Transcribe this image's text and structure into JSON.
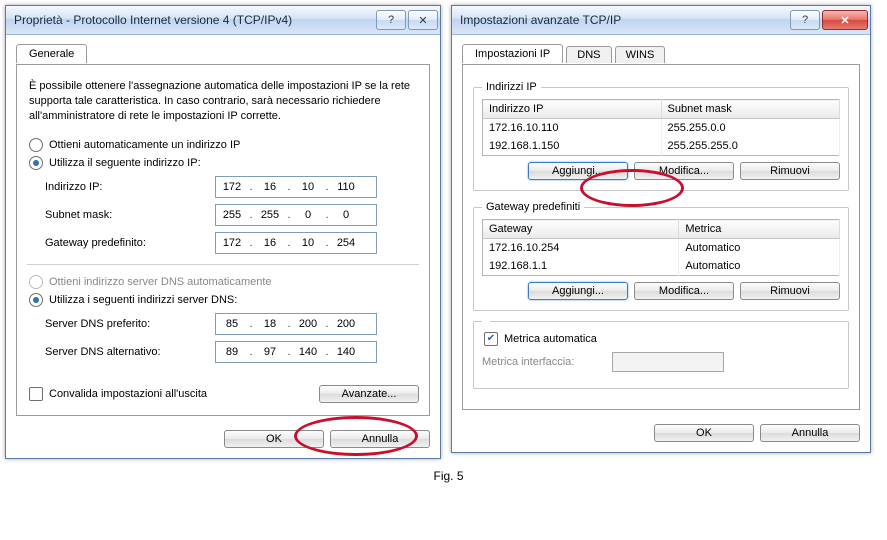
{
  "figure_caption": "Fig. 5",
  "left": {
    "title": "Proprietà - Protocollo Internet versione 4 (TCP/IPv4)",
    "tab_general": "Generale",
    "intro": "È possibile ottenere l'assegnazione automatica delle impostazioni IP se la rete supporta tale caratteristica. In caso contrario, sarà necessario richiedere all'amministratore di rete le impostazioni IP corrette.",
    "radio_auto_ip": "Ottieni automaticamente un indirizzo IP",
    "radio_use_ip": "Utilizza il seguente indirizzo IP:",
    "label_ip": "Indirizzo IP:",
    "label_mask": "Subnet mask:",
    "label_gw": "Gateway predefinito:",
    "ip": {
      "a": "172",
      "b": "16",
      "c": "10",
      "d": "110"
    },
    "mask": {
      "a": "255",
      "b": "255",
      "c": "0",
      "d": "0"
    },
    "gw": {
      "a": "172",
      "b": "16",
      "c": "10",
      "d": "254"
    },
    "radio_auto_dns": "Ottieni indirizzo server DNS automaticamente",
    "radio_use_dns": "Utilizza i seguenti indirizzi server DNS:",
    "label_dns1": "Server DNS preferito:",
    "label_dns2": "Server DNS alternativo:",
    "dns1": {
      "a": "85",
      "b": "18",
      "c": "200",
      "d": "200"
    },
    "dns2": {
      "a": "89",
      "b": "97",
      "c": "140",
      "d": "140"
    },
    "validate": "Convalida impostazioni all'uscita",
    "btn_adv": "Avanzate...",
    "btn_ok": "OK",
    "btn_cancel": "Annulla"
  },
  "right": {
    "title": "Impostazioni avanzate TCP/IP",
    "tabs": {
      "ip": "Impostazioni IP",
      "dns": "DNS",
      "wins": "WINS"
    },
    "group_ip": "Indirizzi IP",
    "ip_table_headers": {
      "col1": "Indirizzo IP",
      "col2": "Subnet mask"
    },
    "ip_table_rows": [
      {
        "ip": "172.16.10.110",
        "mask": "255.255.0.0"
      },
      {
        "ip": "192.168.1.150",
        "mask": "255.255.255.0"
      }
    ],
    "group_gw": "Gateway predefiniti",
    "gw_table_headers": {
      "col1": "Gateway",
      "col2": "Metrica"
    },
    "gw_table_rows": [
      {
        "gw": "172.16.10.254",
        "metric": "Automatico"
      },
      {
        "gw": "192.168.1.1",
        "metric": "Automatico"
      }
    ],
    "btn_add": "Aggiungi...",
    "btn_edit": "Modifica...",
    "btn_remove": "Rimuovi",
    "auto_metric": "Metrica automatica",
    "iface_metric": "Metrica interfaccia:",
    "btn_ok": "OK",
    "btn_cancel": "Annulla"
  }
}
